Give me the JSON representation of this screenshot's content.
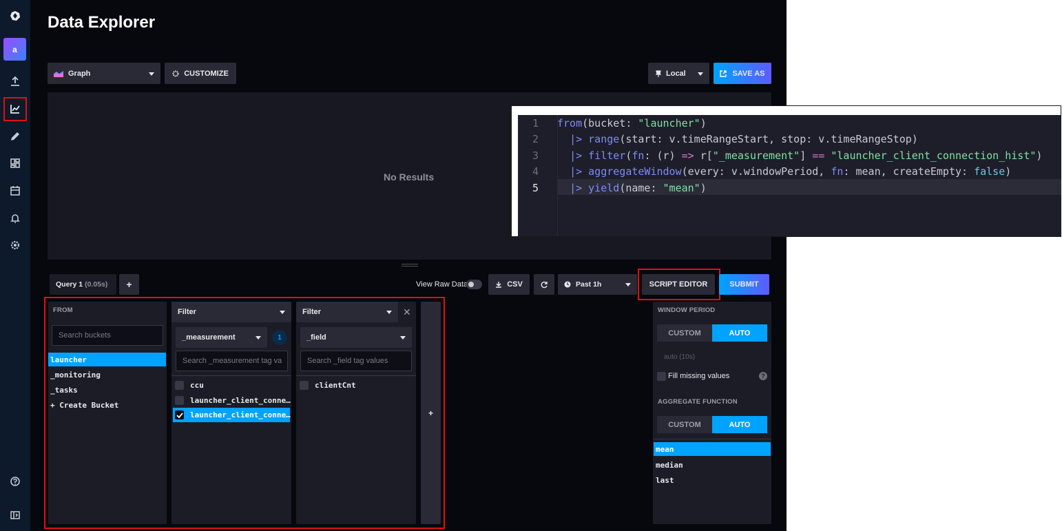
{
  "page": {
    "title": "Data Explorer"
  },
  "sidebar": {
    "avatar_letter": "a",
    "items": [
      "logo",
      "avatar",
      "upload",
      "data-explorer",
      "notebooks",
      "dashboards",
      "tasks",
      "alerts",
      "settings",
      "help",
      "collapse"
    ]
  },
  "toolbar": {
    "graph_label": "Graph",
    "customize_label": "CUSTOMIZE",
    "timezone_label": "Local",
    "save_as_label": "SAVE AS"
  },
  "graph": {
    "empty_text": "No Results"
  },
  "query_bar": {
    "query_tab_label": "Query 1",
    "query_tab_time": "(0.05s)",
    "add_query_label": "+",
    "view_raw_label": "View Raw Data",
    "csv_label": "CSV",
    "time_range_label": "Past 1h",
    "script_editor_label": "SCRIPT EDITOR",
    "submit_label": "SUBMIT"
  },
  "from_panel": {
    "heading": "FROM",
    "search_placeholder": "Search buckets",
    "buckets": [
      "launcher",
      "_monitoring",
      "_tasks",
      "+ Create Bucket"
    ],
    "selected_bucket": "launcher"
  },
  "filter_1": {
    "header": "Filter",
    "key": "_measurement",
    "count_badge": "1",
    "search_placeholder": "Search _measurement tag va",
    "values": [
      "ccu",
      "launcher_client_conne…",
      "launcher_client_conne…"
    ],
    "checked": [
      false,
      false,
      true
    ]
  },
  "filter_2": {
    "header": "Filter",
    "key": "_field",
    "search_placeholder": "Search _field tag values",
    "values": [
      "clientCnt"
    ],
    "checked": [
      false
    ]
  },
  "add_filter_label": "+",
  "aggregate": {
    "window_period_label": "WINDOW PERIOD",
    "custom_label": "CUSTOM",
    "auto_label": "AUTO",
    "auto_value": "auto (10s)",
    "fill_missing_label": "Fill missing values",
    "help_glyph": "?",
    "aggregate_function_label": "AGGREGATE FUNCTION",
    "functions": [
      "mean",
      "median",
      "last"
    ],
    "selected_function": "mean"
  },
  "script_overlay": {
    "line_numbers": [
      "1",
      "2",
      "3",
      "4",
      "5"
    ],
    "active_line": 5,
    "lines": [
      [
        {
          "t": "from",
          "c": "k"
        },
        {
          "t": "(bucket: "
        },
        {
          "t": "\"launcher\"",
          "c": "s"
        },
        {
          "t": ")"
        }
      ],
      [
        {
          "t": "  "
        },
        {
          "t": "|>",
          "c": "k"
        },
        {
          "t": " "
        },
        {
          "t": "range",
          "c": "k"
        },
        {
          "t": "(start: v.timeRangeStart, stop: v.timeRangeStop)"
        }
      ],
      [
        {
          "t": "  "
        },
        {
          "t": "|>",
          "c": "k"
        },
        {
          "t": " "
        },
        {
          "t": "filter",
          "c": "k"
        },
        {
          "t": "("
        },
        {
          "t": "fn",
          "c": "k"
        },
        {
          "t": ": (r) "
        },
        {
          "t": "=>",
          "c": "op"
        },
        {
          "t": " r["
        },
        {
          "t": "\"_measurement\"",
          "c": "s"
        },
        {
          "t": "] "
        },
        {
          "t": "==",
          "c": "op"
        },
        {
          "t": " "
        },
        {
          "t": "\"launcher_client_connection_hist\"",
          "c": "s"
        },
        {
          "t": ")"
        }
      ],
      [
        {
          "t": "  "
        },
        {
          "t": "|>",
          "c": "k"
        },
        {
          "t": " "
        },
        {
          "t": "aggregateWindow",
          "c": "k"
        },
        {
          "t": "(every: v.windowPeriod, "
        },
        {
          "t": "fn",
          "c": "k"
        },
        {
          "t": ": mean, createEmpty: "
        },
        {
          "t": "false",
          "c": "f"
        },
        {
          "t": ")"
        }
      ],
      [
        {
          "t": "  "
        },
        {
          "t": "|>",
          "c": "k"
        },
        {
          "t": " "
        },
        {
          "t": "yield",
          "c": "k"
        },
        {
          "t": "(name: "
        },
        {
          "t": "\"mean\"",
          "c": "s"
        },
        {
          "t": ")"
        }
      ]
    ]
  },
  "colors": {
    "accent_blue": "#00a3ff",
    "highlight_red": "#e01010",
    "background": "#07070e",
    "panel": "#1c1c27"
  }
}
